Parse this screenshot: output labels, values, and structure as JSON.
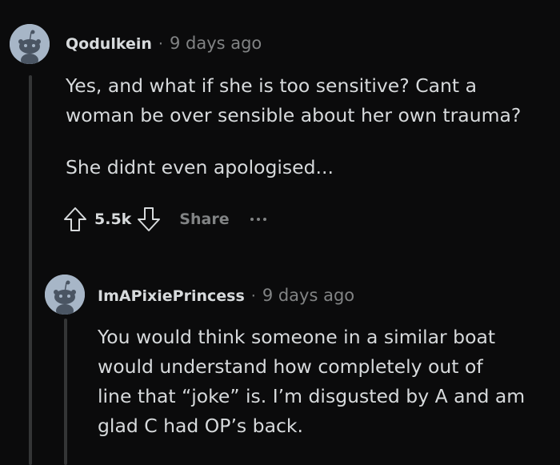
{
  "comments": [
    {
      "username": "Qodulkein",
      "separator": "·",
      "time": "9 days ago",
      "paragraphs": [
        "Yes, and what if she is too sensitive? Cant a",
        "woman be over sensible about her own trauma?",
        "She didnt even apologised..."
      ],
      "score": "5.5k",
      "share_label": "Share",
      "avatar_icon": "reddit-snoo-avatar-icon"
    },
    {
      "username": "ImAPixiePrincess",
      "separator": "·",
      "time": "9 days ago",
      "paragraphs": [
        "You would think someone in a similar boat",
        "would understand how completely out of",
        "line that “joke” is. I’m disgusted by A and am",
        "glad C had OP’s back."
      ],
      "avatar_icon": "reddit-snoo-avatar-icon"
    }
  ],
  "colors": {
    "background": "#0b0b0c",
    "text": "#d7dadc",
    "muted": "#818384",
    "thread_line": "#343536",
    "avatar_bg": "#a7b6c7"
  }
}
